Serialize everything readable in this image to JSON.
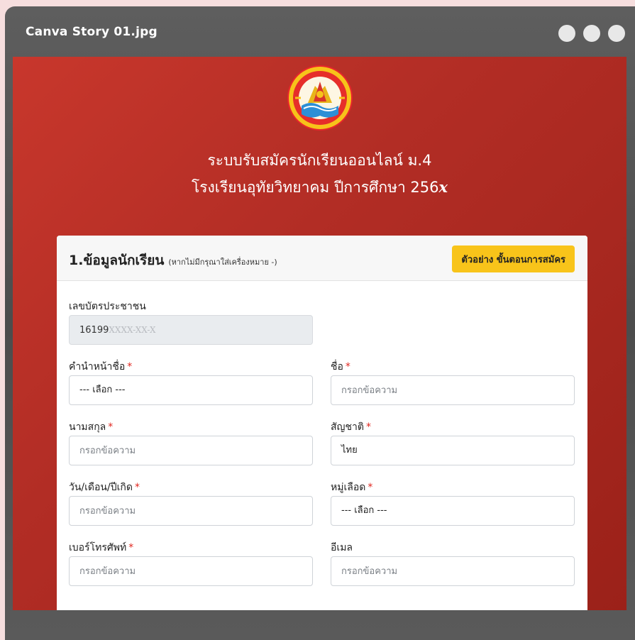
{
  "window": {
    "title": "Canva Story 01.jpg"
  },
  "page": {
    "heading_line1": "ระบบรับสมัครนักเรียนออนไลน์ ม.4",
    "heading_line2_prefix": "โรงเรียนอุทัยวิทยาคม ปีการศึกษา 256",
    "heading_line2_suffix": "x",
    "logo_icon": "school-seal-logo"
  },
  "card": {
    "title": "1.ข้อมูลนักเรียน",
    "note": "(หากไม่มีกรุณาใส่เครื่องหมาย -)",
    "example_button": "ตัวอย่าง ขั้นตอนการสมัคร"
  },
  "form": {
    "id_label": "เลขบัตรประชาชน",
    "id_value": "16199",
    "id_mask": "XXXX-XX-X",
    "prefix_label": "คำนำหน้าชื่อ",
    "prefix_value": "--- เลือก ---",
    "name_label": "ชื่อ",
    "name_placeholder": "กรอกข้อความ",
    "surname_label": "นามสกุล",
    "surname_placeholder": "กรอกข้อความ",
    "nationality_label": "สัญชาติ",
    "nationality_value": "ไทย",
    "dob_label": "วัน/เดือน/ปีเกิด",
    "dob_placeholder": "กรอกข้อความ",
    "blood_label": "หมู่เลือด",
    "blood_value": "--- เลือก ---",
    "phone_label": "เบอร์โทรศัพท์",
    "phone_placeholder": "กรอกข้อความ",
    "email_label": "อีเมล",
    "email_placeholder": "กรอกข้อความ",
    "required_mark": "*"
  },
  "colors": {
    "background_red": "#b22d25",
    "button_yellow": "#f8c41a",
    "required_red": "#e0261f"
  }
}
